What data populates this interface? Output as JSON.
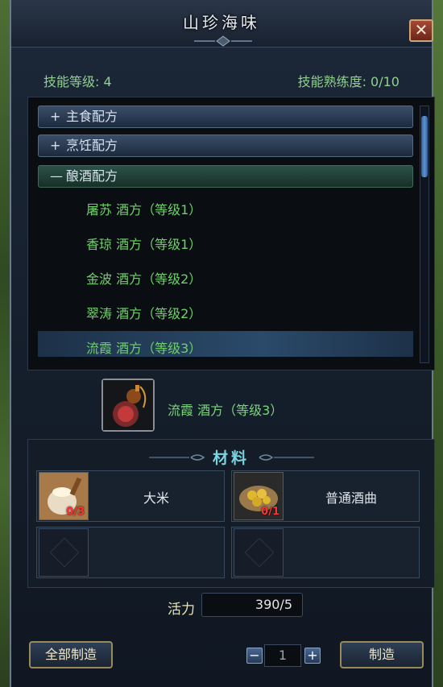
{
  "window": {
    "title": "山珍海味",
    "close_label": "✕"
  },
  "stats": {
    "skill_level": "技能等级: 4",
    "proficiency": "技能熟练度: 0/10"
  },
  "categories": [
    {
      "sign": "+",
      "label": "主食配方"
    },
    {
      "sign": "+",
      "label": "烹饪配方"
    },
    {
      "sign": "—",
      "label": "酿酒配方"
    }
  ],
  "recipes": [
    "屠苏 酒方（等级1）",
    "香琼 酒方（等级1）",
    "金波 酒方（等级2）",
    "翠涛 酒方（等级2）",
    "流霞 酒方（等级3）"
  ],
  "selected": {
    "name": "流霞 酒方（等级3）",
    "icon": "gourd-wine-icon"
  },
  "materials": {
    "title": "材料",
    "items": [
      {
        "name": "大米",
        "count": "0/3",
        "icon": "rice-sack-icon"
      },
      {
        "name": "普通酒曲",
        "count": "0/1",
        "icon": "yeast-basket-icon"
      }
    ]
  },
  "vitality": {
    "label": "活力",
    "value": "390/5"
  },
  "buttons": {
    "make_all": "全部制造",
    "make": "制造",
    "minus": "−",
    "plus": "+"
  },
  "quantity": "1"
}
